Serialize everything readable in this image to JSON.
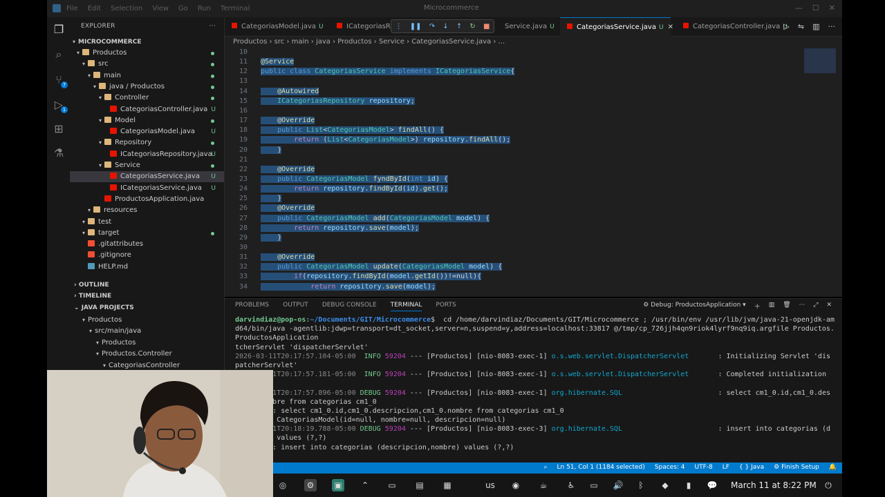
{
  "window": {
    "title": "Microcommerce",
    "menu": [
      "File",
      "Edit",
      "Selection",
      "View",
      "Go",
      "Run",
      "Terminal"
    ]
  },
  "sidebar": {
    "header": "EXPLORER",
    "project": "MICROCOMMERCE",
    "tree": [
      {
        "label": "Productos",
        "indent": 0,
        "kind": "folder",
        "status": "dot"
      },
      {
        "label": "src",
        "indent": 1,
        "kind": "folder",
        "status": "dot"
      },
      {
        "label": "main",
        "indent": 2,
        "kind": "folder",
        "status": "dot"
      },
      {
        "label": "java / Productos",
        "indent": 3,
        "kind": "folder",
        "status": "dot"
      },
      {
        "label": "Controller",
        "indent": 4,
        "kind": "folder",
        "status": "dot"
      },
      {
        "label": "CategoriasController.java",
        "indent": 5,
        "kind": "java",
        "status": "U"
      },
      {
        "label": "Model",
        "indent": 4,
        "kind": "folder",
        "status": "dot"
      },
      {
        "label": "CategoriasModel.java",
        "indent": 5,
        "kind": "java",
        "status": "U"
      },
      {
        "label": "Repository",
        "indent": 4,
        "kind": "folder",
        "status": "dot"
      },
      {
        "label": "ICategoriasRepository.java",
        "indent": 5,
        "kind": "java",
        "status": "U"
      },
      {
        "label": "Service",
        "indent": 4,
        "kind": "folder",
        "status": "dot"
      },
      {
        "label": "CategoriasService.java",
        "indent": 5,
        "kind": "java",
        "status": "U",
        "selected": true
      },
      {
        "label": "ICategoriasService.java",
        "indent": 5,
        "kind": "java",
        "status": "U"
      },
      {
        "label": "ProductosApplication.java",
        "indent": 4,
        "kind": "java",
        "status": ""
      },
      {
        "label": "resources",
        "indent": 2,
        "kind": "folder",
        "status": ""
      },
      {
        "label": "test",
        "indent": 1,
        "kind": "folder",
        "status": ""
      },
      {
        "label": "target",
        "indent": 1,
        "kind": "folder",
        "status": "dot"
      },
      {
        "label": ".gitattributes",
        "indent": 1,
        "kind": "git",
        "status": ""
      },
      {
        "label": ".gitignore",
        "indent": 1,
        "kind": "git",
        "status": ""
      },
      {
        "label": "HELP.md",
        "indent": 1,
        "kind": "md",
        "status": ""
      }
    ],
    "sections": [
      "OUTLINE",
      "TIMELINE",
      "JAVA PROJECTS"
    ],
    "java_projects": [
      {
        "label": "Productos",
        "indent": 0
      },
      {
        "label": "src/main/java",
        "indent": 1
      },
      {
        "label": "Productos",
        "indent": 2
      },
      {
        "label": "Productos.Controller",
        "indent": 2
      },
      {
        "label": "CategoriasController",
        "indent": 3
      }
    ]
  },
  "tabs": [
    {
      "label": "CategoriasModel.java",
      "status": "U",
      "active": false
    },
    {
      "label": "ICategoriasRe",
      "status": "",
      "active": false
    },
    {
      "label": "Service.java",
      "status": "U",
      "active": false
    },
    {
      "label": "CategoriasService.java",
      "status": "U",
      "active": true
    },
    {
      "label": "CategoriasController.java",
      "status": "U",
      "active": false
    }
  ],
  "breadcrumb": [
    "Productos",
    "src",
    "main",
    "java",
    "Productos",
    "Service",
    "CategoriasService.java",
    "..."
  ],
  "editor": {
    "lines": [
      {
        "n": "10",
        "t": ""
      },
      {
        "n": "11",
        "t": "@Service"
      },
      {
        "n": "12",
        "t": "public class CategoriasService implements ICategoriasService{"
      },
      {
        "n": "13",
        "t": ""
      },
      {
        "n": "14",
        "t": "    @Autowired"
      },
      {
        "n": "15",
        "t": "    ICategoriasRepository repository;"
      },
      {
        "n": "16",
        "t": ""
      },
      {
        "n": "17",
        "t": "    @Override"
      },
      {
        "n": "18",
        "t": "    public List<CategoriasModel> findAll() {"
      },
      {
        "n": "19",
        "t": "        return (List<CategoriasModel>) repository.findAll();"
      },
      {
        "n": "20",
        "t": "    }"
      },
      {
        "n": "21",
        "t": ""
      },
      {
        "n": "22",
        "t": "    @Override"
      },
      {
        "n": "23",
        "t": "    public CategoriasModel fyndById(int id) {"
      },
      {
        "n": "24",
        "t": "        return repository.findById(id).get();"
      },
      {
        "n": "25",
        "t": "    }"
      },
      {
        "n": "26",
        "t": "    @Override"
      },
      {
        "n": "27",
        "t": "    public CategoriasModel add(CategoriasModel model) {"
      },
      {
        "n": "28",
        "t": "        return repository.save(model);"
      },
      {
        "n": "29",
        "t": "    }"
      },
      {
        "n": "30",
        "t": ""
      },
      {
        "n": "31",
        "t": "    @Override"
      },
      {
        "n": "32",
        "t": "    public CategoriasModel update(CategoriasModel model) {"
      },
      {
        "n": "33",
        "t": "        if(repository.findById(model.getId())!=null){"
      },
      {
        "n": "34",
        "t": "            return repository.save(model);"
      }
    ]
  },
  "panel": {
    "tabs": [
      "PROBLEMS",
      "OUTPUT",
      "DEBUG CONSOLE",
      "TERMINAL",
      "PORTS"
    ],
    "active_tab": "TERMINAL",
    "session": "Debug: ProductosApplication",
    "terminal": [
      "darvindiaz@pop-os:~/Documents/GIT/Microcommerce$  cd /home/darvindiaz/Documents/GIT/Microcommerce ; /usr/bin/env /usr/lib/jvm/java-21-openjdk-am",
      "d64/bin/java -agentlib:jdwp=transport=dt_socket,server=n,suspend=y,address=localhost:33817 @/tmp/cp_726jjh4qn9riok4lyrf9nq9iq.argfile Productos.",
      "ProductosApplication",
      "tcherServlet 'dispatcherServlet'",
      "2026-03-11T20:17:57.104-05:00  INFO 59204 --- [Productos] [nio-8083-exec-1] o.s.web.servlet.DispatcherServlet       : Initializing Servlet 'dis",
      "patcherServlet'",
      "2026-03-11T20:17:57.181-05:00  INFO 59204 --- [Productos] [nio-8083-exec-1] o.s.web.servlet.DispatcherServlet       : Completed initialization",
      "",
      "2026-03-11T20:17:57.896-05:00 DEBUG 59204 --- [Productos] [nio-8083-exec-1] org.hibernate.SQL                       : select cm1_0.id,cm1_0.des",
      "cm1_0.nombre from categorias cm1_0",
      "Hibernate: select cm1_0.id,cm1_0.descripcion,cm1_0.nombre from categorias cm1_0",
      "Recibido: CategoriasModel(id=null, nombre=null, descripcion=null)",
      "2026-03-11T20:18:19.788-05:00 DEBUG 59204 --- [Productos] [nio-8083-exec-3] org.hibernate.SQL                       : insert into categorias (d",
      "n,nombre) values (?,?)",
      "Hibernate: insert into categorias (descripcion,nombre) values (?,?)"
    ]
  },
  "statusbar": {
    "position": "Ln 51, Col 1 (1184 selected)",
    "spaces": "Spaces: 4",
    "encoding": "UTF-8",
    "eol": "LF",
    "language": "Java",
    "setup": "Finish Setup"
  },
  "taskbar": {
    "keyboard": "us",
    "clock": "March 11 at 8:22 PM"
  },
  "colors": {
    "accent": "#007acc",
    "editor_bg": "#1f1f1f",
    "sidebar_bg": "#181818",
    "selection": "#264f78"
  }
}
